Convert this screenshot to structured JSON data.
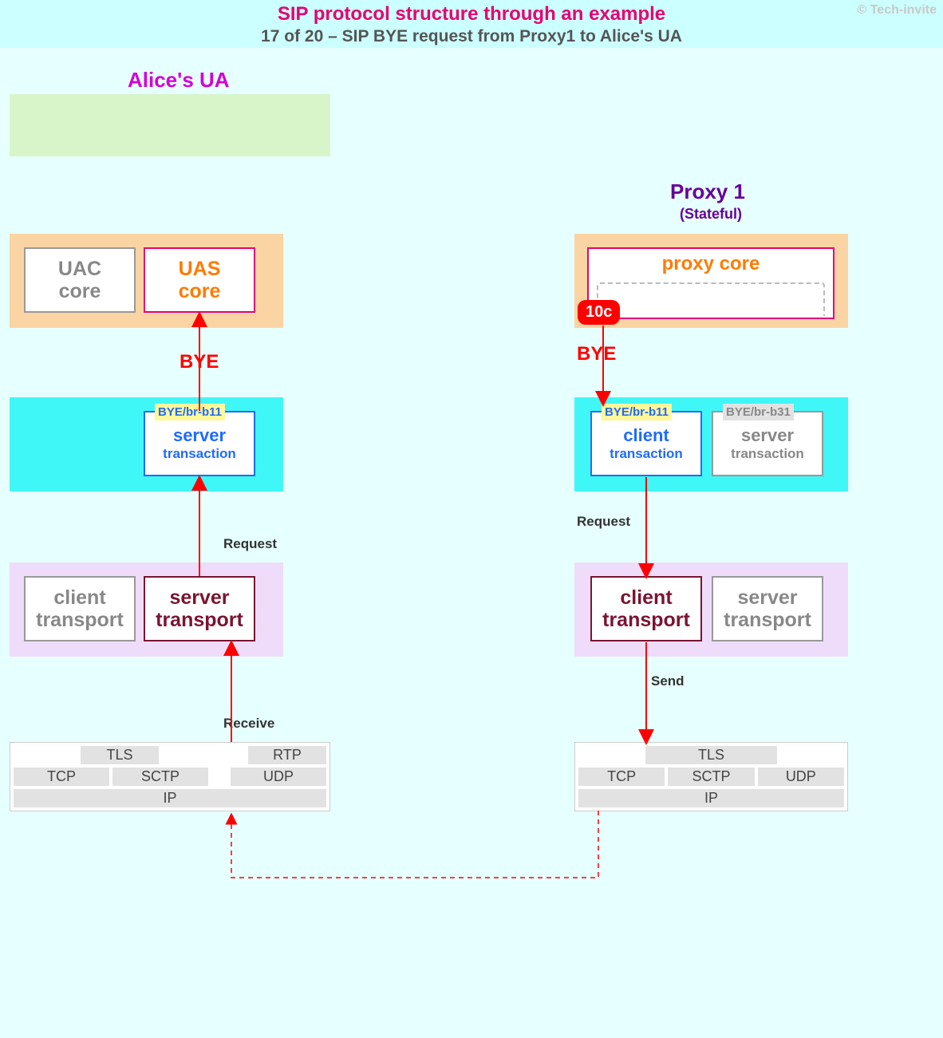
{
  "header": {
    "title": "SIP protocol structure through an example",
    "subtitle": "17 of 20 – SIP BYE request from Proxy1 to Alice's UA",
    "copyright": "© Tech-invite"
  },
  "left": {
    "title": "Alice's UA",
    "cores_uac_l1": "UAC",
    "cores_uac_l2": "core",
    "cores_uas_l1": "UAS",
    "cores_uas_l2": "core",
    "bye": "BYE",
    "txn_tag": "BYE/br-b11",
    "txn_l1": "server",
    "txn_l2": "transaction",
    "req_label": "Request",
    "trans_client_l1": "client",
    "trans_client_l2": "transport",
    "trans_server_l1": "server",
    "trans_server_l2": "transport",
    "recv_label": "Receive"
  },
  "right": {
    "title": "Proxy 1",
    "title_sub": "(Stateful)",
    "proxy_core": "proxy core",
    "badge": "10c",
    "bye": "BYE",
    "txn_client_tag": "BYE/br-b11",
    "txn_client_l1": "client",
    "txn_client_l2": "transaction",
    "txn_server_tag": "BYE/br-b31",
    "txn_server_l1": "server",
    "txn_server_l2": "transaction",
    "req_label": "Request",
    "trans_client_l1": "client",
    "trans_client_l2": "transport",
    "trans_server_l1": "server",
    "trans_server_l2": "transport",
    "send_label": "Send"
  },
  "stack": {
    "tls": "TLS",
    "rtp": "RTP",
    "tcp": "TCP",
    "sctp": "SCTP",
    "udp": "UDP",
    "ip": "IP"
  }
}
